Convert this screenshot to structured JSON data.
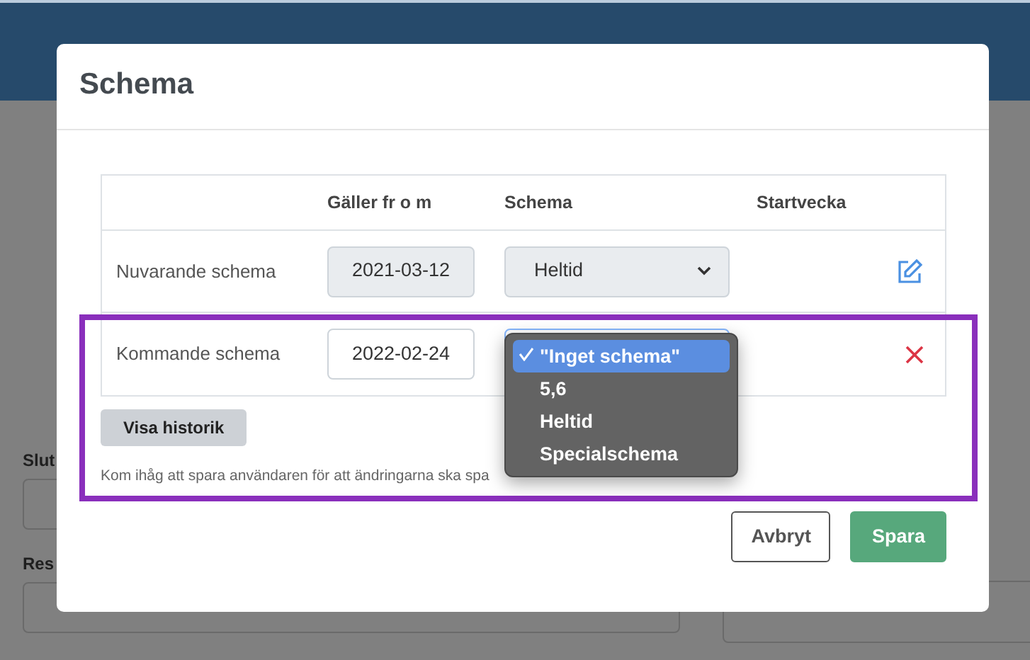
{
  "background": {
    "labels": [
      "Slut",
      "Res"
    ]
  },
  "modal": {
    "title": "Schema"
  },
  "table": {
    "columns": [
      "Gäller fr o m",
      "Schema",
      "Startvecka"
    ],
    "rows": [
      {
        "label": "Nuvarande schema",
        "date": "2021-03-12",
        "schema": "Heltid",
        "disabled": true,
        "kind": "edit"
      },
      {
        "label": "Kommande schema",
        "date": "2022-02-24",
        "disabled": false,
        "kind": "delete"
      }
    ]
  },
  "dropdown": {
    "options": [
      {
        "label": "\"Inget schema\"",
        "selected": true
      },
      {
        "label": "5,6",
        "selected": false
      },
      {
        "label": "Heltid",
        "selected": false
      },
      {
        "label": "Specialschema",
        "selected": false
      }
    ]
  },
  "history_button": "Visa historik",
  "note": "Kom ihåg att spara användaren för att ändringarna ska spa",
  "buttons": [
    {
      "label": "Avbryt",
      "kind": "secondary"
    },
    {
      "label": "Spara",
      "kind": "primary"
    }
  ]
}
